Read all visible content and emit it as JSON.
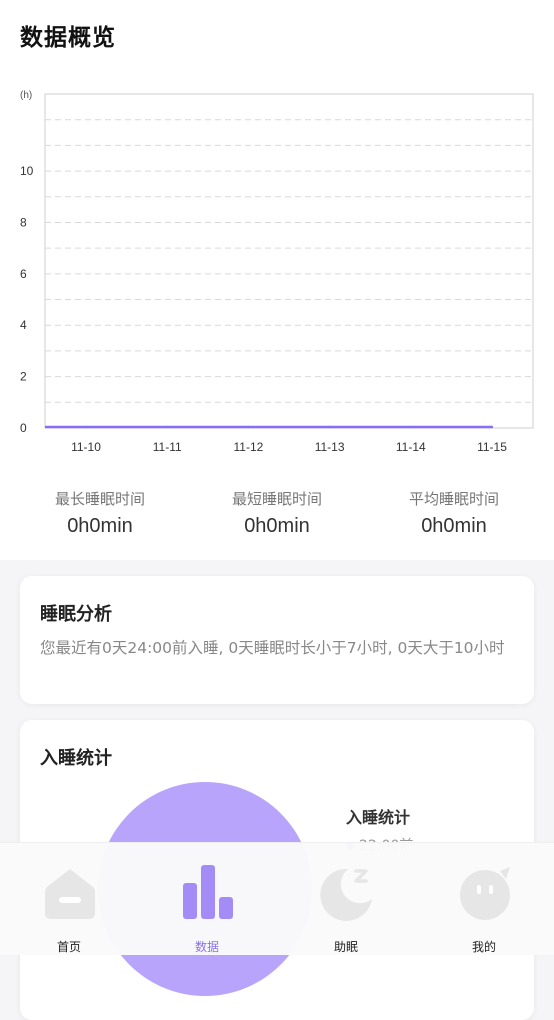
{
  "header": {
    "title": "数据概览"
  },
  "chart_data": {
    "type": "line",
    "title": "",
    "ylabel": "(h)",
    "xlabel": "",
    "categories": [
      "11-10",
      "11-11",
      "11-12",
      "11-13",
      "11-14",
      "11-15"
    ],
    "series": [
      {
        "values": [
          0,
          0,
          0,
          0,
          0,
          0
        ]
      }
    ],
    "ylim": [
      0,
      13
    ],
    "yticks": [
      0,
      2,
      4,
      6,
      8,
      10
    ],
    "grid": true,
    "line_color": "#8a6ff0"
  },
  "stats": {
    "longest": {
      "label": "最长睡眠时间",
      "value": "0h0min"
    },
    "shortest": {
      "label": "最短睡眠时间",
      "value": "0h0min"
    },
    "average": {
      "label": "平均睡眠时间",
      "value": "0h0min"
    }
  },
  "analysis": {
    "title": "睡眠分析",
    "text": "您最近有0天24:00前入睡, 0天睡眠时长小于7小时, 0天大于10小时"
  },
  "sleep_stats": {
    "title": "入睡统计",
    "legend_title": "入睡统计",
    "legend_item": "22:00前",
    "pie_color": "#b9a4fb",
    "dot_color": "#8b6ff0"
  },
  "tabbar": {
    "tabs": [
      {
        "label": "首页",
        "icon": "home-icon"
      },
      {
        "label": "数据",
        "icon": "bar-chart-icon"
      },
      {
        "label": "助眠",
        "icon": "moon-icon"
      },
      {
        "label": "我的",
        "icon": "profile-face-icon"
      }
    ],
    "active_color": "#8a6ff0"
  }
}
